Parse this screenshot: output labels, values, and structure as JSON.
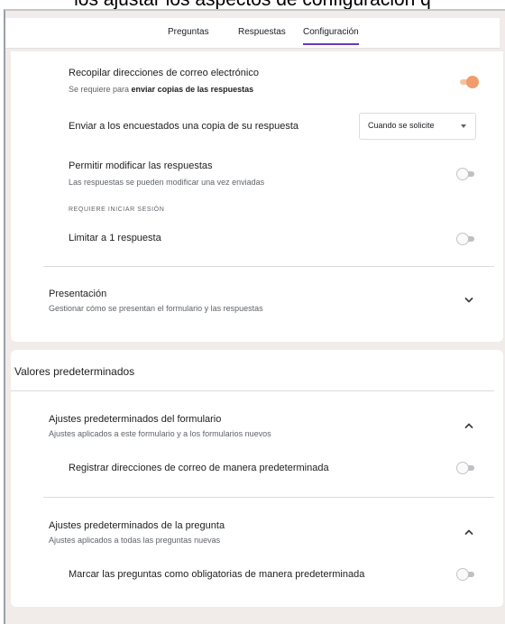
{
  "caption": "los ajustar los aspectos de configuración q",
  "tabs": [
    {
      "label": "Preguntas"
    },
    {
      "label": "Respuestas"
    },
    {
      "label": "Configuración"
    }
  ],
  "responses": {
    "collect_email": {
      "label": "Recopilar direcciones de correo electrónico",
      "sub_prefix": "Se requiere para ",
      "sub_bold": "enviar copias de las respuestas",
      "enabled": true
    },
    "send_copy": {
      "label": "Enviar a los encuestados una copia de su respuesta",
      "selected": "Cuando se solicite"
    },
    "allow_edit": {
      "label": "Permitir modificar las respuestas",
      "sub": "Las respuestas se pueden modificar una vez enviadas",
      "enabled": false
    },
    "sign_in_overline": "REQUIERE INICIAR SESIÓN",
    "limit_one": {
      "label": "Limitar a 1 respuesta",
      "enabled": false
    }
  },
  "presentation": {
    "title": "Presentación",
    "sub": "Gestionar cómo se presentan el formulario y las respuestas",
    "icon": "chevron-down-icon"
  },
  "defaults": {
    "heading": "Valores predeterminados",
    "form_defaults": {
      "title": "Ajustes predeterminados del formulario",
      "sub": "Ajustes aplicados a este formulario y a los formularios nuevos",
      "icon": "chevron-up-icon",
      "collect_email_default": {
        "label": "Registrar direcciones de correo de manera predeterminada",
        "enabled": false
      }
    },
    "question_defaults": {
      "title": "Ajustes predeterminados de la pregunta",
      "sub": "Ajustes aplicados a todas las preguntas nuevas",
      "icon": "chevron-up-icon",
      "required_default": {
        "label": "Marcar las preguntas como obligatorias de manera predeterminada",
        "enabled": false
      }
    }
  },
  "colors": {
    "accent": "#673ab7",
    "toggle_on": "#f09c6c",
    "page_background": "#f1ece9"
  }
}
